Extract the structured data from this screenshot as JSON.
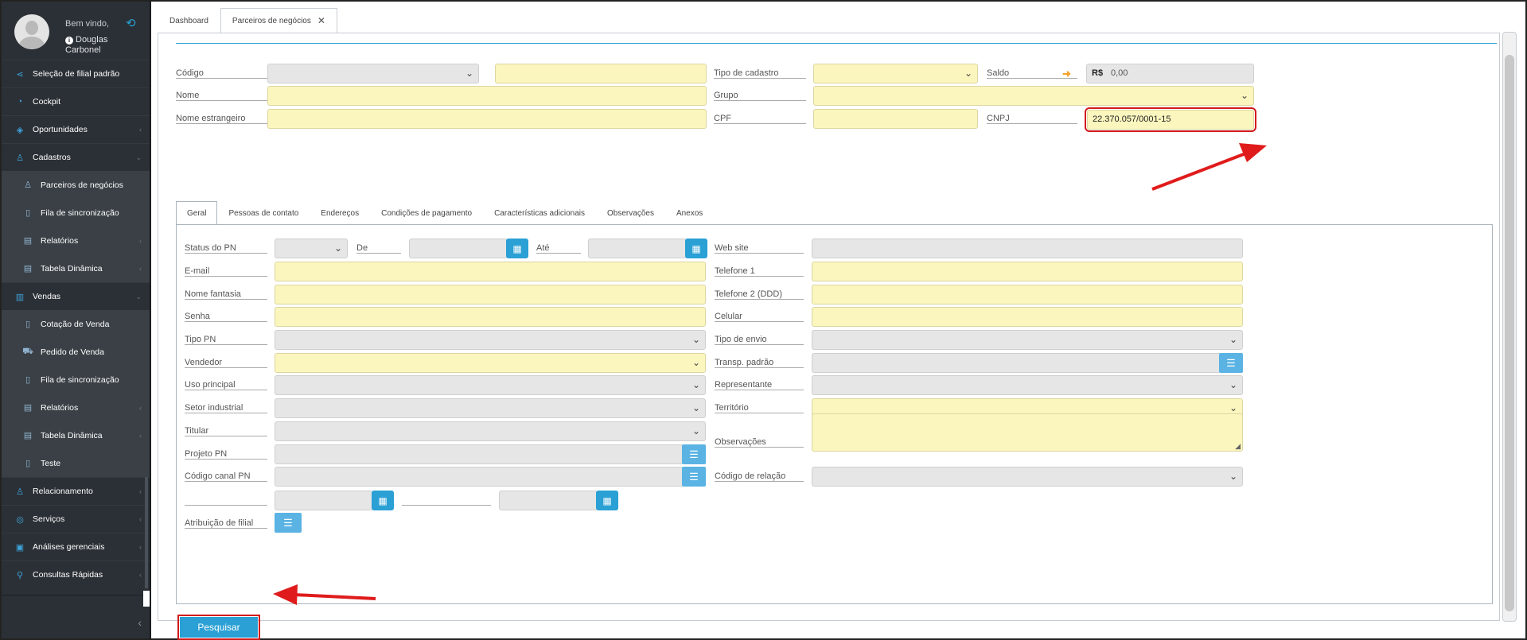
{
  "colors": {
    "accent": "#2aa0d5",
    "sidebar": "#2b3036",
    "required_field": "#fbf6be",
    "disabled_field": "#e6e6e6",
    "highlight": "#d21b1b"
  },
  "user": {
    "welcome": "Bem vindo,",
    "name": "Douglas Carbonel"
  },
  "sidebar": {
    "items": [
      {
        "label": "Seleção de filial padrão",
        "icon": "share-icon",
        "level": "top"
      },
      {
        "label": "Cockpit",
        "icon": "gauge-icon",
        "level": "top"
      },
      {
        "label": "Oportunidades",
        "icon": "layers-icon",
        "level": "top",
        "arrow": "‹"
      },
      {
        "label": "Cadastros",
        "icon": "user-icon",
        "level": "top",
        "arrow": "⌄"
      },
      {
        "label": "Parceiros de negócios",
        "icon": "user-outline-icon",
        "level": "sub"
      },
      {
        "label": "Fila de sincronização",
        "icon": "file-icon",
        "level": "sub"
      },
      {
        "label": "Relatórios",
        "icon": "table-icon",
        "level": "sub",
        "arrow": "‹"
      },
      {
        "label": "Tabela Dinâmica",
        "icon": "table-icon",
        "level": "sub",
        "arrow": "‹"
      },
      {
        "label": "Vendas",
        "icon": "bar-chart-icon",
        "level": "top",
        "arrow": "⌄"
      },
      {
        "label": "Cotação de Venda",
        "icon": "file-icon",
        "level": "sub"
      },
      {
        "label": "Pedido de Venda",
        "icon": "cart-icon",
        "level": "sub"
      },
      {
        "label": "Fila de sincronização",
        "icon": "file-icon",
        "level": "sub"
      },
      {
        "label": "Relatórios",
        "icon": "table-icon",
        "level": "sub",
        "arrow": "‹"
      },
      {
        "label": "Tabela Dinâmica",
        "icon": "table-icon",
        "level": "sub",
        "arrow": "‹"
      },
      {
        "label": "Teste",
        "icon": "file-icon",
        "level": "sub"
      },
      {
        "label": "Relacionamento",
        "icon": "people-icon",
        "level": "top",
        "arrow": "‹"
      },
      {
        "label": "Serviços",
        "icon": "lifebuoy-icon",
        "level": "top",
        "arrow": "‹"
      },
      {
        "label": "Análises gerenciais",
        "icon": "report-icon",
        "level": "top",
        "arrow": "‹"
      },
      {
        "label": "Consultas Rápidas",
        "icon": "search-icon",
        "level": "top",
        "arrow": "‹"
      }
    ]
  },
  "tabs": {
    "dashboard": "Dashboard",
    "partners": "Parceiros de negócios"
  },
  "header_form": {
    "codigo": "Código",
    "tipo_cadastro": "Tipo de cadastro",
    "saldo": "Saldo",
    "currency": "R$",
    "saldo_value": "0,00",
    "nome": "Nome",
    "grupo": "Grupo",
    "nome_estrangeiro": "Nome estrangeiro",
    "cpf": "CPF",
    "cnpj": "CNPJ",
    "cnpj_value": "22.370.057/0001-15"
  },
  "inner_tabs": [
    "Geral",
    "Pessoas de contato",
    "Endereços",
    "Condições de pagamento",
    "Características adicionais",
    "Observações",
    "Anexos"
  ],
  "geral": {
    "status_pn": "Status do PN",
    "de": "De",
    "ate": "Até",
    "web_site": "Web site",
    "email": "E-mail",
    "telefone1": "Telefone 1",
    "nome_fantasia": "Nome fantasia",
    "telefone2": "Telefone 2 (DDD)",
    "senha": "Senha",
    "celular": "Celular",
    "tipo_pn": "Tipo PN",
    "tipo_envio": "Tipo de envio",
    "vendedor": "Vendedor",
    "transp_padrao": "Transp. padrão",
    "uso_principal": "Uso principal",
    "representante": "Representante",
    "setor_industrial": "Setor industrial",
    "territorio": "Território",
    "titular": "Titular",
    "observacoes": "Observações",
    "projeto_pn": "Projeto PN",
    "codigo_canal_pn": "Código canal PN",
    "codigo_relacao": "Código de relação",
    "atribuicao_filial": "Atribuição de filial"
  },
  "search_button": "Pesquisar"
}
